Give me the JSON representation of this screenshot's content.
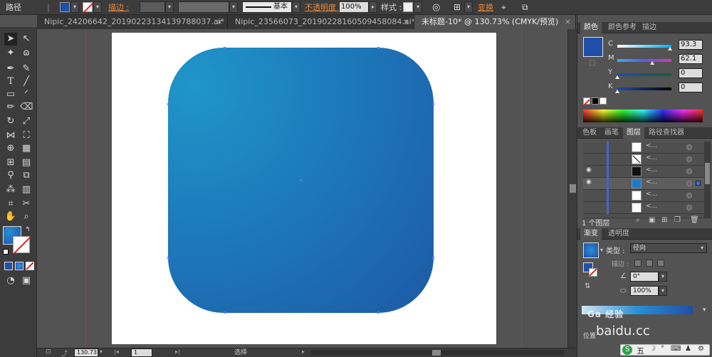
{
  "control_bar": {
    "title": "路径",
    "stroke_label": "描边 :",
    "stroke_style": "基本",
    "opacity_label": "不透明度 :",
    "opacity_value": "100%",
    "style_label": "样式 :",
    "transform_label": "变换"
  },
  "tabs": [
    {
      "label": "Nipic_24206642_20190223134139788037.ai* @ 50...",
      "close": "×"
    },
    {
      "label": "Nipic_23566073_20190228160509458084.ai* @ 98...",
      "close": "×"
    },
    {
      "label": "未标题-10* @ 130.73% (CMYK/预览)",
      "close": "×"
    }
  ],
  "status": {
    "zoom": "130.73",
    "page": "1",
    "mode": "选择"
  },
  "color_panel": {
    "tabs": [
      "颜色",
      "颜色参考",
      "描边"
    ],
    "fill_color": "#1f4fa8",
    "channels": [
      {
        "label": "C",
        "value": "93.3"
      },
      {
        "label": "M",
        "value": "62.1"
      },
      {
        "label": "Y",
        "value": "0"
      },
      {
        "label": "K",
        "value": "0"
      }
    ]
  },
  "layers_panel": {
    "tabs": [
      "色板",
      "画笔",
      "图层",
      "路径查找器"
    ],
    "layer_count": "1 个图层",
    "row_names": [
      "<...",
      "<...",
      "<...",
      "<...",
      "<...",
      "<...",
      "<..."
    ]
  },
  "gradient_panel": {
    "tabs": [
      "渐变",
      "透明度"
    ],
    "type_label": "类型 :",
    "type_value": "径向",
    "stroke_label": "描边 :",
    "angle_value": "0°",
    "aspect_value": "100%",
    "position_label": "位置"
  },
  "watermark": {
    "text": "baidu.cc",
    "ime": [
      "五",
      "☽",
      "°",
      "⌨",
      "♟",
      "⚙"
    ]
  },
  "colors": {
    "accent": "#e8883a",
    "gradient_start": "#1f96c9",
    "gradient_end": "#1d4fa0"
  }
}
